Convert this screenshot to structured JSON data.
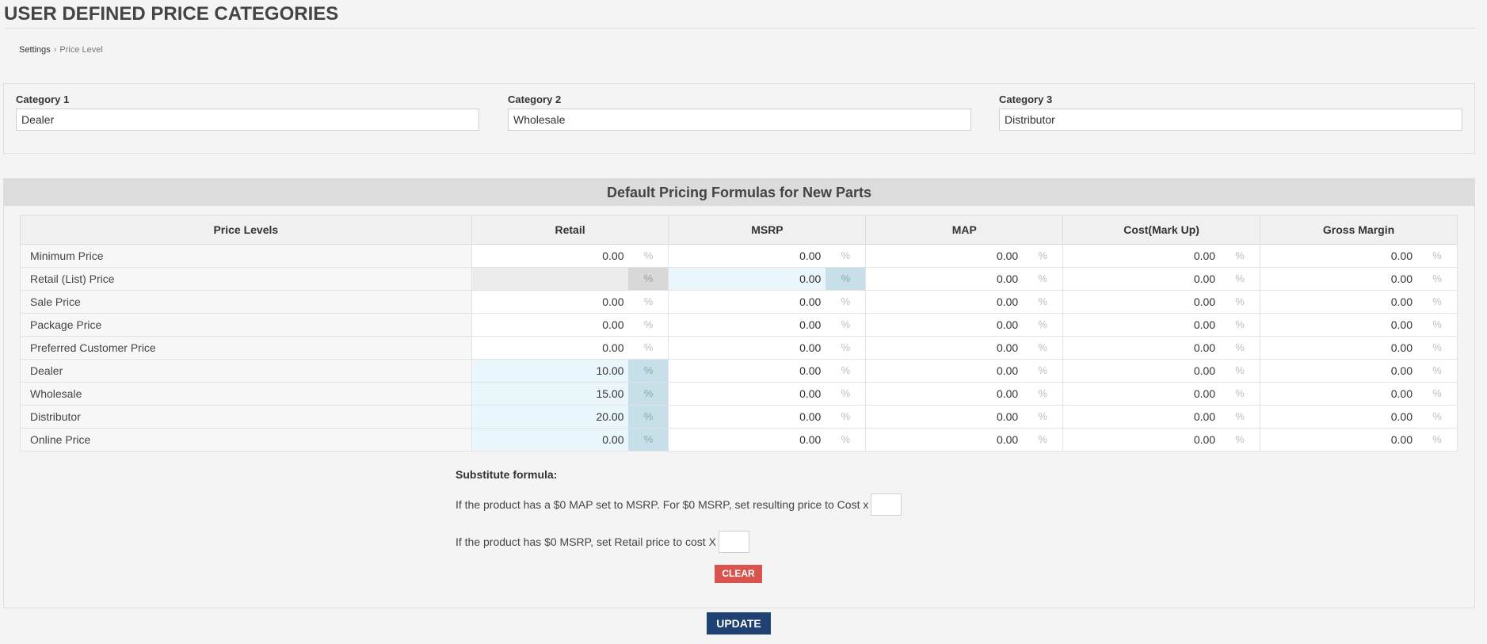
{
  "page": {
    "title": "USER DEFINED PRICE CATEGORIES"
  },
  "breadcrumb": {
    "parent": "Settings",
    "separator": "›",
    "current": "Price Level"
  },
  "categories": [
    {
      "label": "Category 1",
      "value": "Dealer"
    },
    {
      "label": "Category 2",
      "value": "Wholesale"
    },
    {
      "label": "Category 3",
      "value": "Distributor"
    }
  ],
  "formulas": {
    "title": "Default Pricing Formulas for New Parts",
    "columns": [
      "Price Levels",
      "Retail",
      "MSRP",
      "MAP",
      "Cost(Mark Up)",
      "Gross Margin"
    ],
    "percent_symbol": "%",
    "rows": [
      {
        "label": "Minimum Price",
        "values": [
          "0.00",
          "0.00",
          "0.00",
          "0.00",
          "0.00"
        ],
        "states": [
          "",
          "",
          "",
          "",
          ""
        ]
      },
      {
        "label": "Retail (List) Price",
        "values": [
          "",
          "0.00",
          "0.00",
          "0.00",
          "0.00"
        ],
        "states": [
          "disabled",
          "active",
          "",
          "",
          ""
        ]
      },
      {
        "label": "Sale Price",
        "values": [
          "0.00",
          "0.00",
          "0.00",
          "0.00",
          "0.00"
        ],
        "states": [
          "",
          "",
          "",
          "",
          ""
        ]
      },
      {
        "label": "Package Price",
        "values": [
          "0.00",
          "0.00",
          "0.00",
          "0.00",
          "0.00"
        ],
        "states": [
          "",
          "",
          "",
          "",
          ""
        ]
      },
      {
        "label": "Preferred Customer Price",
        "values": [
          "0.00",
          "0.00",
          "0.00",
          "0.00",
          "0.00"
        ],
        "states": [
          "",
          "",
          "",
          "",
          ""
        ]
      },
      {
        "label": "Dealer",
        "values": [
          "10.00",
          "0.00",
          "0.00",
          "0.00",
          "0.00"
        ],
        "states": [
          "active",
          "",
          "",
          "",
          ""
        ]
      },
      {
        "label": "Wholesale",
        "values": [
          "15.00",
          "0.00",
          "0.00",
          "0.00",
          "0.00"
        ],
        "states": [
          "active",
          "",
          "",
          "",
          ""
        ]
      },
      {
        "label": "Distributor",
        "values": [
          "20.00",
          "0.00",
          "0.00",
          "0.00",
          "0.00"
        ],
        "states": [
          "active",
          "",
          "",
          "",
          ""
        ]
      },
      {
        "label": "Online Price",
        "values": [
          "0.00",
          "0.00",
          "0.00",
          "0.00",
          "0.00"
        ],
        "states": [
          "active",
          "",
          "",
          "",
          ""
        ]
      }
    ]
  },
  "substitute": {
    "title": "Substitute formula:",
    "map_rule": "If the product has a $0 MAP set to MSRP. For $0 MSRP, set resulting price to Cost x",
    "map_rule_value": "",
    "msrp_rule": "If the product has $0 MSRP, set Retail price to cost X",
    "msrp_rule_value": ""
  },
  "buttons": {
    "clear": "CLEAR",
    "update": "UPDATE"
  },
  "colors": {
    "update_button": "#1f4272",
    "clear_button": "#d9534f",
    "active_cell": "#e9f6fb",
    "active_percent": "#c7dfe8"
  }
}
